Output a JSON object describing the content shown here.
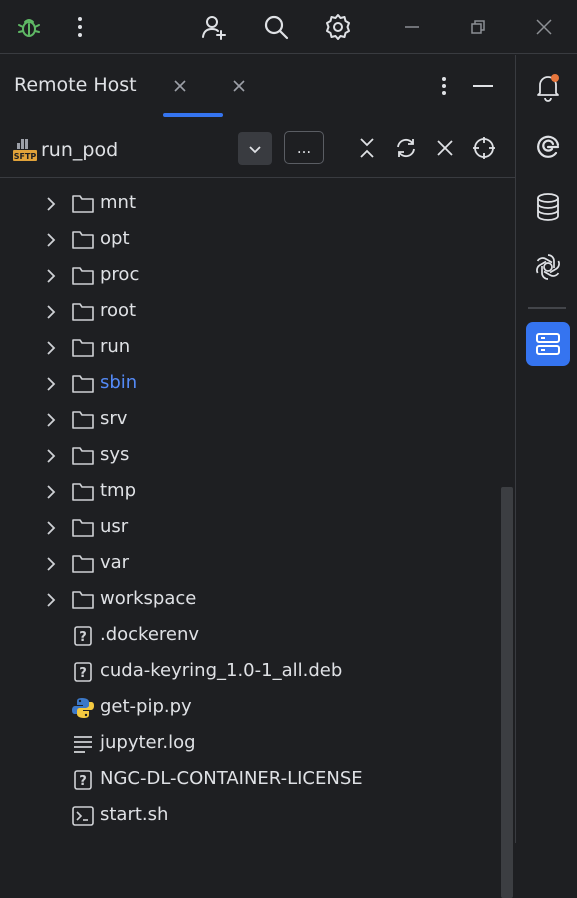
{
  "panel": {
    "title": "Remote Host"
  },
  "toolbar": {
    "host_name": "run_pod",
    "more_label": "..."
  },
  "tree": [
    {
      "name": "mnt",
      "type": "folder",
      "highlight": false
    },
    {
      "name": "opt",
      "type": "folder",
      "highlight": false
    },
    {
      "name": "proc",
      "type": "folder",
      "highlight": false
    },
    {
      "name": "root",
      "type": "folder",
      "highlight": false
    },
    {
      "name": "run",
      "type": "folder",
      "highlight": false
    },
    {
      "name": "sbin",
      "type": "folder",
      "highlight": true
    },
    {
      "name": "srv",
      "type": "folder",
      "highlight": false
    },
    {
      "name": "sys",
      "type": "folder",
      "highlight": false
    },
    {
      "name": "tmp",
      "type": "folder",
      "highlight": false
    },
    {
      "name": "usr",
      "type": "folder",
      "highlight": false
    },
    {
      "name": "var",
      "type": "folder",
      "highlight": false
    },
    {
      "name": "workspace",
      "type": "folder",
      "highlight": false
    },
    {
      "name": ".dockerenv",
      "type": "unknown-file",
      "highlight": false
    },
    {
      "name": "cuda-keyring_1.0-1_all.deb",
      "type": "unknown-file",
      "highlight": false
    },
    {
      "name": "get-pip.py",
      "type": "python-file",
      "highlight": false
    },
    {
      "name": "jupyter.log",
      "type": "text-file",
      "highlight": false
    },
    {
      "name": "NGC-DL-CONTAINER-LICENSE",
      "type": "unknown-file",
      "highlight": false
    },
    {
      "name": "start.sh",
      "type": "shell-file",
      "highlight": false
    }
  ],
  "sftp_badge": "SFTP",
  "colors": {
    "accent": "#3574f0",
    "highlight_text": "#548af7",
    "bug_green": "#5fb865",
    "sftp_orange": "#e0a23a"
  }
}
